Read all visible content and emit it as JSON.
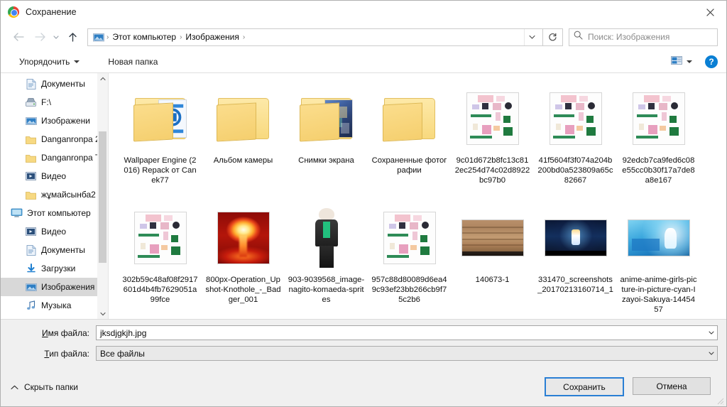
{
  "window": {
    "title": "Сохранение",
    "app_icon": "chrome-icon",
    "close_label": "✕"
  },
  "nav": {
    "back_icon": "back-arrow-icon",
    "forward_icon": "forward-arrow-icon",
    "recent_icon": "recent-locations-icon",
    "up_icon": "up-arrow-icon",
    "breadcrumb_icon": "pictures-folder-icon",
    "crumbs": [
      "Этот компьютер",
      "Изображения"
    ],
    "separator": "›",
    "dropdown_icon": "chevron-down-icon",
    "refresh_icon": "refresh-icon",
    "search": {
      "icon": "search-icon",
      "placeholder": "Поиск: Изображения",
      "value": ""
    }
  },
  "toolbar": {
    "organize_label": "Упорядочить",
    "organize_caret": "chevron-down-icon",
    "new_folder_label": "Новая папка",
    "view_icon": "view-layout-icon",
    "view_caret": "chevron-down-icon",
    "help_label": "?"
  },
  "sidebar": {
    "items": [
      {
        "label": "Документы",
        "icon": "documents-icon",
        "pinned": true,
        "indent": 1,
        "selected": false
      },
      {
        "label": "F:\\",
        "icon": "drive-icon",
        "pinned": true,
        "indent": 1,
        "selected": false
      },
      {
        "label": "Изображени",
        "icon": "pictures-icon",
        "pinned": true,
        "indent": 1,
        "selected": false
      },
      {
        "label": "Danganronpa 2 ",
        "icon": "folder-icon",
        "pinned": false,
        "indent": 1,
        "selected": false
      },
      {
        "label": "Danganronpa Tr",
        "icon": "folder-icon",
        "pinned": false,
        "indent": 1,
        "selected": false
      },
      {
        "label": "Видео",
        "icon": "videos-icon",
        "pinned": false,
        "indent": 1,
        "selected": false
      },
      {
        "label": "жұмайсынба2",
        "icon": "folder-icon",
        "pinned": false,
        "indent": 1,
        "selected": false
      },
      {
        "label": "Этот компьютер",
        "icon": "this-pc-icon",
        "pinned": false,
        "indent": 0,
        "selected": false
      },
      {
        "label": "Видео",
        "icon": "videos-icon",
        "pinned": false,
        "indent": 1,
        "selected": false
      },
      {
        "label": "Документы",
        "icon": "documents-icon",
        "pinned": false,
        "indent": 1,
        "selected": false
      },
      {
        "label": "Загрузки",
        "icon": "downloads-icon",
        "pinned": false,
        "indent": 1,
        "selected": false
      },
      {
        "label": "Изображения",
        "icon": "pictures-icon",
        "pinned": false,
        "indent": 1,
        "selected": true
      },
      {
        "label": "Музыка",
        "icon": "music-icon",
        "pinned": false,
        "indent": 1,
        "selected": false
      }
    ],
    "scroll_up_icon": "chevron-up-icon",
    "scroll_down_icon": "chevron-down-icon"
  },
  "files": {
    "items": [
      {
        "name": "Wallpaper Engine (2016) Repack от Canek77",
        "kind": "folder",
        "thumb": "folder-wallpaper-engine"
      },
      {
        "name": "Альбом камеры",
        "kind": "folder",
        "thumb": "folder-plain"
      },
      {
        "name": "Снимки экрана",
        "kind": "folder",
        "thumb": "folder-screenshots"
      },
      {
        "name": "Сохраненные фотографии",
        "kind": "folder",
        "thumb": "folder-plain"
      },
      {
        "name": "9c01d672b8fc13c812ec254d74c02d8922bc97b0",
        "kind": "image",
        "thumb": "sheet-pink"
      },
      {
        "name": "41f5604f3f074a204b200bd0a523809a65c82667",
        "kind": "image",
        "thumb": "sheet-pink"
      },
      {
        "name": "92edcb7ca9fed6c08e55cc0b30f17a7de8a8e167",
        "kind": "image",
        "thumb": "sheet-pink"
      },
      {
        "name": "302b59c48af08f2917601d4b4fb7629051a99fce",
        "kind": "image",
        "thumb": "sheet-pink"
      },
      {
        "name": "800px-Operation_Upshot-Knothole_-_Badger_001",
        "kind": "image",
        "thumb": "nuclear-blast"
      },
      {
        "name": "903-9039568_image-nagito-komaeda-sprites",
        "kind": "image",
        "thumb": "anime-sprite"
      },
      {
        "name": "957c88d80089d6ea49c93ef23bb266cb9f75c2b6",
        "kind": "image",
        "thumb": "sheet-pink"
      },
      {
        "name": "140673-1",
        "kind": "image",
        "thumb": "rock-texture"
      },
      {
        "name": "331470_screenshots_20170213160714_1",
        "kind": "image",
        "thumb": "game-capture"
      },
      {
        "name": "anime-anime-girls-picture-in-picture-cyan-Izayoi-Sakuya-1445457",
        "kind": "image",
        "thumb": "anime-cyan"
      }
    ]
  },
  "form": {
    "filename_label": "Имя файла:",
    "filename_label_accel": "И",
    "filename_label_rest": "мя файла:",
    "filename_value": "jksdjgkjh.jpg",
    "filetype_label_accel": "Т",
    "filetype_label_rest": "ип файла:",
    "filetype_value": "Все файлы",
    "dropdown_icon": "chevron-down-icon"
  },
  "footer": {
    "hide_folders_label": "Скрыть папки",
    "hide_folders_icon": "chevron-up-icon",
    "save_label": "Сохранить",
    "cancel_label": "Отмена"
  },
  "colors": {
    "accent": "#2a7fd4",
    "help_blue": "#0a7fd4",
    "selection_gray": "#d8d8d8",
    "folder_yellow": "#f8d97e",
    "dialog_bg": "#f0f0f0"
  }
}
